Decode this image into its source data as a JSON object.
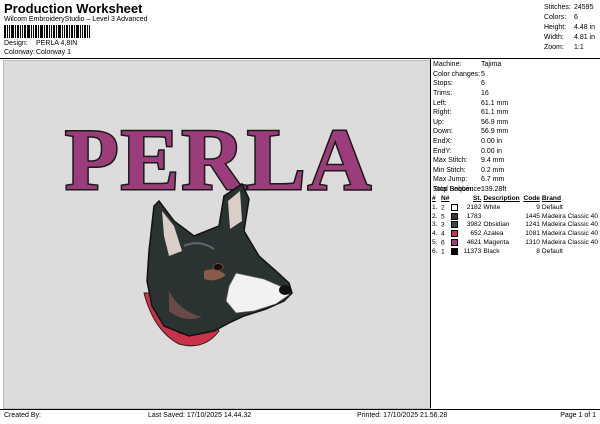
{
  "header": {
    "title": "Production Worksheet",
    "subtitle": "Wilcom EmbroideryStudio – Level 3 Advanced",
    "design_label": "Design:",
    "design_value": "PERLA 4,8IN",
    "colorway_label": "Colorway:",
    "colorway_value": "Colorway 1"
  },
  "stats": [
    {
      "label": "Stitches:",
      "value": "24595"
    },
    {
      "label": "Colors:",
      "value": "6"
    },
    {
      "label": "Height:",
      "value": "4.48 in"
    },
    {
      "label": "Width:",
      "value": "4.81 in"
    },
    {
      "label": "Zoom:",
      "value": "1:1"
    }
  ],
  "design_preview": {
    "text": "PERLA",
    "text_color": "#9a3d7a",
    "outline_color": "#1a1a1a"
  },
  "machine_info": [
    {
      "label": "Machine:",
      "value": "Tajima"
    },
    {
      "label": "Color changes:",
      "value": "5"
    },
    {
      "label": "Stops:",
      "value": "6"
    },
    {
      "label": "Trims:",
      "value": "16"
    },
    {
      "label": "Left:",
      "value": "61.1 mm"
    },
    {
      "label": "Right:",
      "value": "61.1 mm"
    },
    {
      "label": "Up:",
      "value": "56.9 mm"
    },
    {
      "label": "Down:",
      "value": "56.9 mm"
    },
    {
      "label": "EndX:",
      "value": "0.00 in"
    },
    {
      "label": "EndY:",
      "value": "0.00 in"
    },
    {
      "label": "Max Stitch:",
      "value": "9.4 mm"
    },
    {
      "label": "Min Stitch:",
      "value": "0.2 mm"
    },
    {
      "label": "Max Jump:",
      "value": "6.7 mm"
    },
    {
      "label": "Total Bobbin:",
      "value": "139.28ft"
    }
  ],
  "stop_sequence": {
    "title": "Stop Sequence:",
    "headers": [
      "#",
      "N#",
      "St.",
      "Description",
      "Code",
      "Brand"
    ],
    "rows": [
      {
        "num": "1.",
        "n": "2",
        "color": "#ffffff",
        "st": "2182",
        "desc": "White",
        "code": "9",
        "brand": "Default"
      },
      {
        "num": "2.",
        "n": "5",
        "color": "#3c3436",
        "st": "1783",
        "desc": "",
        "code": "1445",
        "brand": "Madeira Classic 40"
      },
      {
        "num": "3.",
        "n": "3",
        "color": "#3a4a4a",
        "st": "3982",
        "desc": "Obsidian",
        "code": "1241",
        "brand": "Madeira Classic 40"
      },
      {
        "num": "4.",
        "n": "4",
        "color": "#c8324a",
        "st": "652",
        "desc": "Azalea",
        "code": "1081",
        "brand": "Madeira Classic 40"
      },
      {
        "num": "5.",
        "n": "6",
        "color": "#9a3d7a",
        "st": "4621",
        "desc": "Magenta",
        "code": "1310",
        "brand": "Madeira Classic 40"
      },
      {
        "num": "6.",
        "n": "1",
        "color": "#000000",
        "st": "11373",
        "desc": "Black",
        "code": "8",
        "brand": "Default"
      }
    ]
  },
  "footer": {
    "created_by": "Created By:",
    "last_saved": "Last Saved: 17/10/2025 14.44.32",
    "printed": "Printed: 17/10/2025 21.56.28",
    "page": "Page 1 of 1"
  }
}
